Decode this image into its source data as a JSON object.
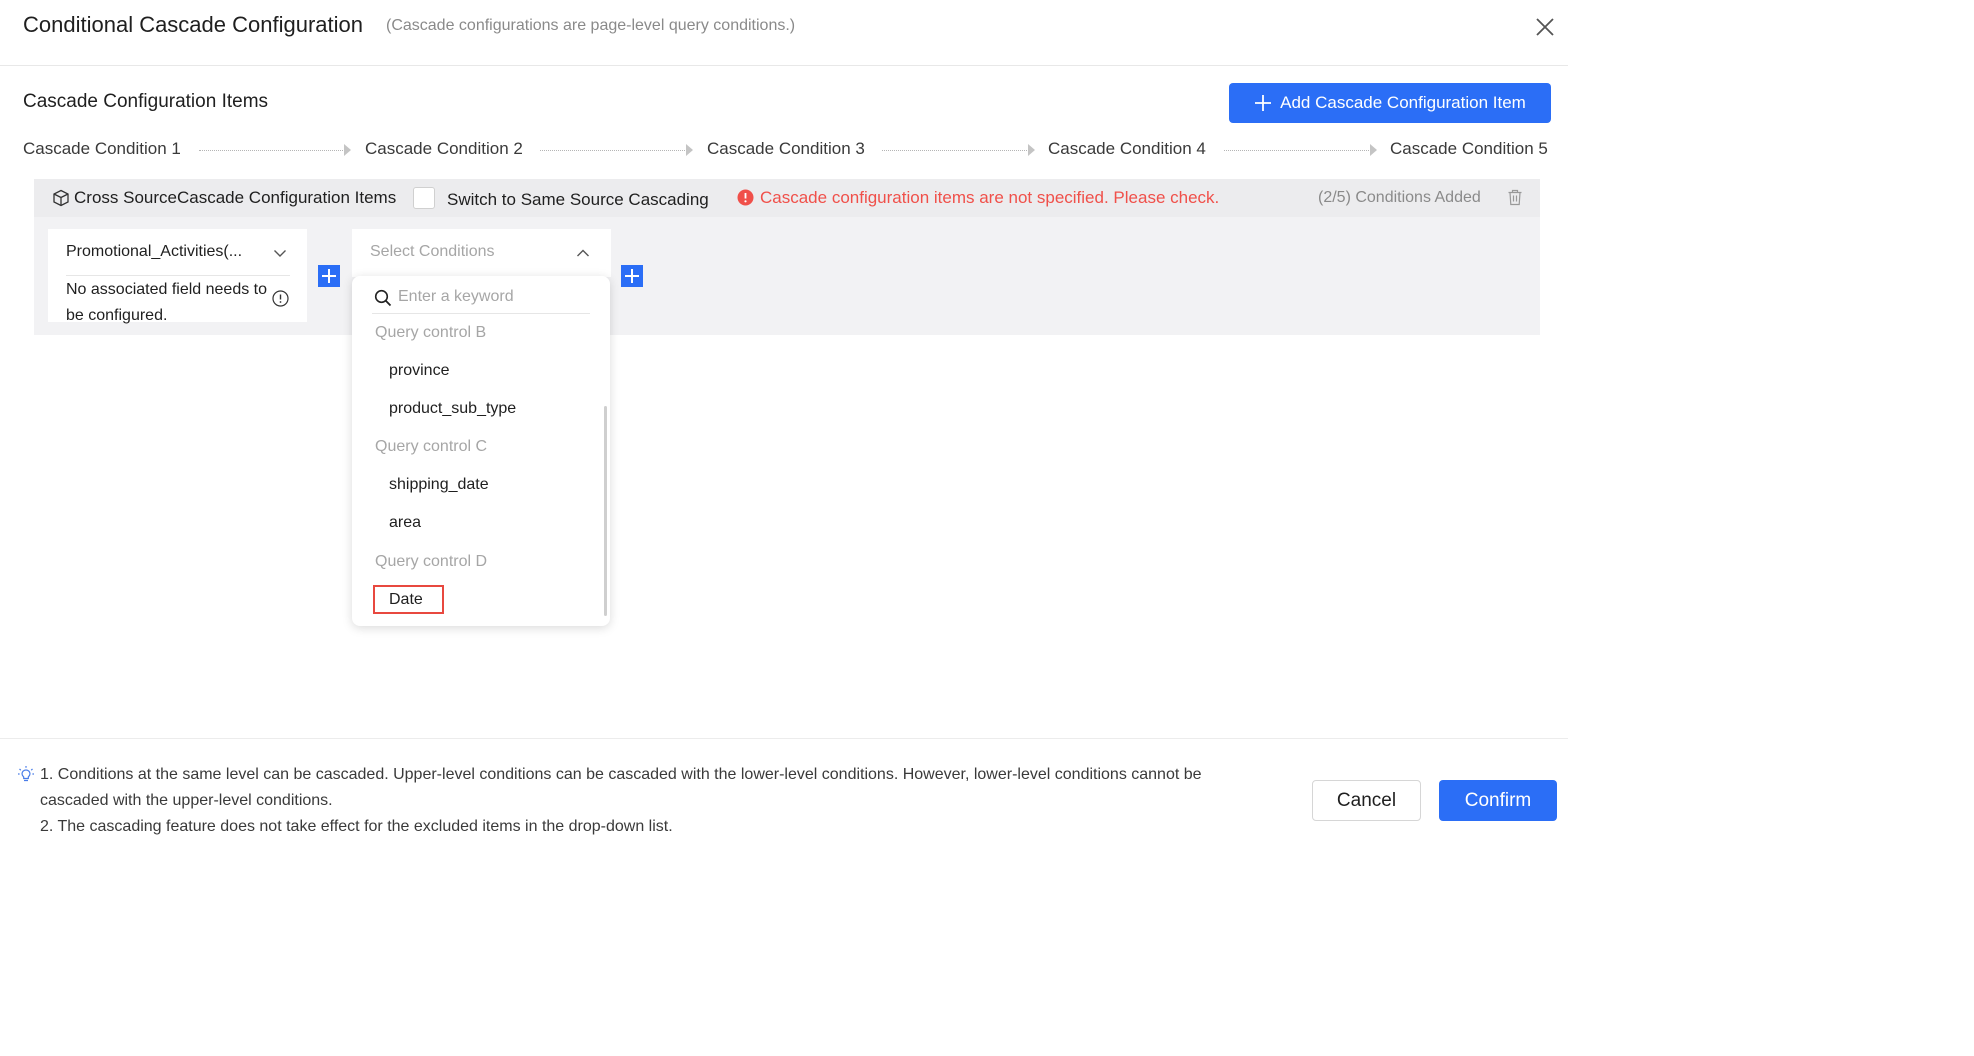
{
  "dialog": {
    "title": "Conditional Cascade Configuration",
    "subtitle": "(Cascade configurations are page-level query conditions.)"
  },
  "section": {
    "title": "Cascade Configuration Items",
    "add_button_label": "Add Cascade Configuration Item"
  },
  "steps": [
    "Cascade Condition 1",
    "Cascade Condition 2",
    "Cascade Condition 3",
    "Cascade Condition 4",
    "Cascade Condition 5"
  ],
  "config_item": {
    "title": "Cross SourceCascade Configuration Items",
    "switch_label": "Switch to Same Source Cascading",
    "switch_checked": false,
    "error_text": "Cascade configuration items are not specified. Please check.",
    "count_text": "(2/5) Conditions Added"
  },
  "condition1": {
    "selected": "Promotional_Activities(...",
    "note": "No associated field needs to be configured."
  },
  "condition2": {
    "placeholder": "Select Conditions"
  },
  "dropdown": {
    "search_placeholder": "Enter a keyword",
    "groups": [
      {
        "label": "Query control B",
        "options": [
          "province",
          "product_sub_type"
        ]
      },
      {
        "label": "Query control C",
        "options": [
          "shipping_date",
          "area"
        ]
      },
      {
        "label": "Query control D",
        "options": [
          "Date"
        ]
      }
    ]
  },
  "footer": {
    "tips": [
      "1. Conditions at the same level can be cascaded. Upper-level conditions can be cascaded with the lower-level conditions. However, lower-level conditions cannot be",
      "cascaded with the upper-level conditions.",
      "2. The cascading feature does not take effect for the excluded items in the drop-down list."
    ],
    "cancel_label": "Cancel",
    "confirm_label": "Confirm"
  },
  "colors": {
    "primary": "#2b6ef6",
    "error": "#f0504a",
    "highlight_box": "#e8483f"
  }
}
